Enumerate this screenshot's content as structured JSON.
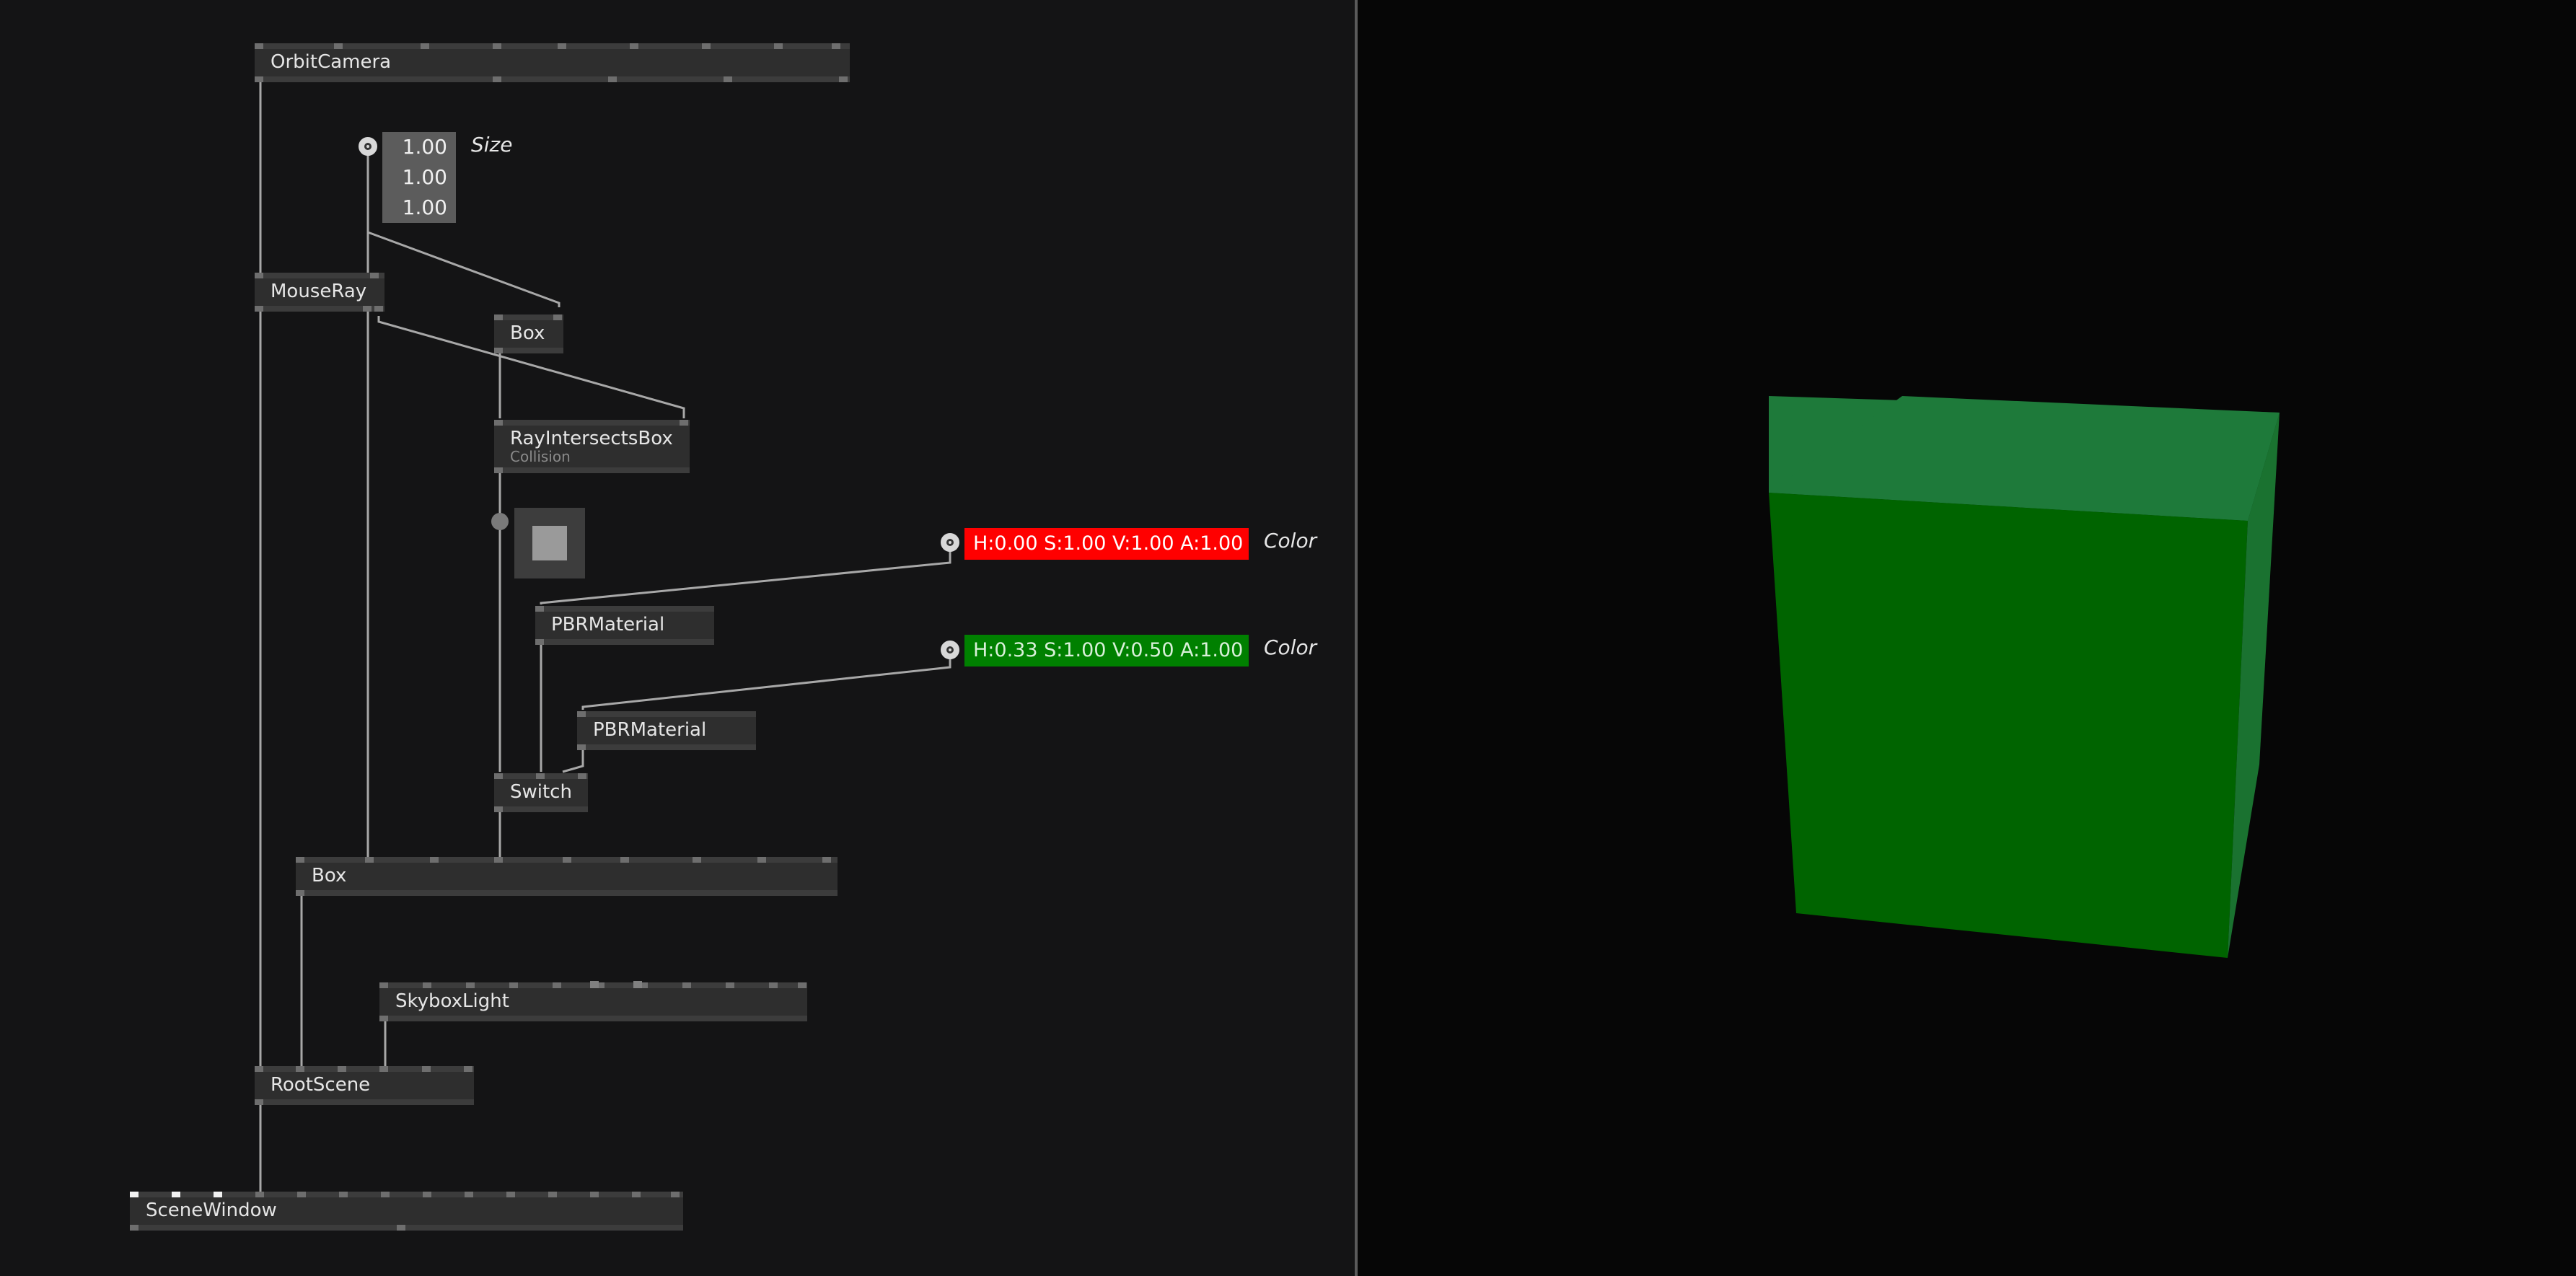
{
  "patch": {
    "nodes": {
      "orbit_camera": "OrbitCamera",
      "mouse_ray": "MouseRay",
      "box_geom": "Box",
      "ray_intersects_box": "RayIntersectsBox",
      "ray_intersects_box_category": "Collision",
      "pbr_material_red": "PBRMaterial",
      "pbr_material_green": "PBRMaterial",
      "switch": "Switch",
      "box_scene": "Box",
      "skybox_light": "SkyboxLight",
      "root_scene": "RootScene",
      "scene_window": "SceneWindow"
    },
    "size_input": {
      "label": "Size",
      "x": "1.00",
      "y": "1.00",
      "z": "1.00"
    },
    "color_red": {
      "label": "Color",
      "value": "H:0.00 S:1.00 V:1.00 A:1.00",
      "swatch": "#ff0000"
    },
    "color_green": {
      "label": "Color",
      "value": "H:0.33 S:1.00 V:0.50 A:1.00",
      "swatch": "#008000"
    }
  },
  "colors": {
    "patch_background": "#141415",
    "render_background": "#060606",
    "node_body": "#2e2e2e",
    "wire": "#a8a8a8",
    "cube_front": "#006400",
    "cube_top": "#1e7a3a",
    "cube_side": "#1a7230"
  }
}
